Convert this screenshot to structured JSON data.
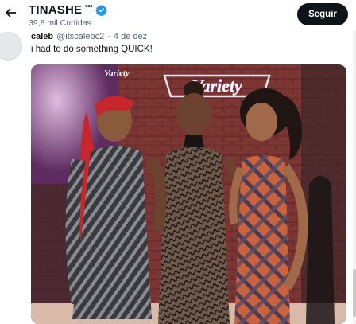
{
  "header": {
    "name": "TINASHE",
    "name_sup": "³³³",
    "likes": "39,8 mil Curtidas",
    "follow_label": "Seguir",
    "verified_icon": "verified-badge-icon",
    "back_icon": "back-arrow-icon"
  },
  "tweet": {
    "author": "caleb",
    "handle": "@itscalebc2",
    "separator": "·",
    "date": "4 de dez",
    "text": "i had to do something QUICK!",
    "media": {
      "sign_text": "Variety",
      "small_sign_text": "Variety",
      "description_icon": "photo"
    }
  },
  "colors": {
    "follow_bg": "#0f1419",
    "verified": "#1d9bf0",
    "muted": "#536471",
    "brick": "#8a3b3a"
  }
}
